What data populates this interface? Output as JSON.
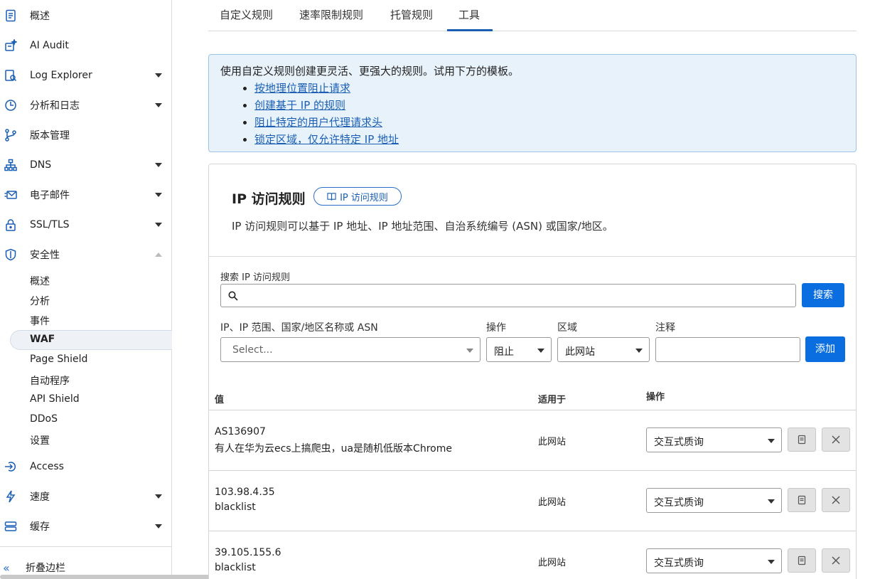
{
  "sidebar": {
    "items": [
      {
        "label": "概述",
        "icon": "document-icon"
      },
      {
        "label": "AI Audit",
        "icon": "ai-audit-icon"
      },
      {
        "label": "Log Explorer",
        "icon": "log-explorer-icon"
      },
      {
        "label": "分析和日志",
        "icon": "clock-chart-icon"
      },
      {
        "label": "版本管理",
        "icon": "branch-icon"
      },
      {
        "label": "DNS",
        "icon": "network-icon"
      },
      {
        "label": "电子邮件",
        "icon": "email-icon"
      },
      {
        "label": "SSL/TLS",
        "icon": "lock-icon"
      },
      {
        "label": "安全性",
        "icon": "shield-icon"
      },
      {
        "label": "Access",
        "icon": "access-icon"
      },
      {
        "label": "速度",
        "icon": "lightning-icon"
      },
      {
        "label": "缓存",
        "icon": "cache-icon"
      }
    ],
    "security_sub": [
      "概述",
      "分析",
      "事件",
      "WAF",
      "Page Shield",
      "自动程序",
      "API Shield",
      "DDoS",
      "设置"
    ],
    "collapse_label": "折叠边栏"
  },
  "tabs": [
    "自定义规则",
    "速率限制规则",
    "托管规则",
    "工具"
  ],
  "info": {
    "text": "使用自定义规则创建更灵活、更强大的规则。试用下方的模板。",
    "links": [
      "按地理位置阻止请求",
      "创建基于 IP 的规则",
      "阻止特定的用户代理请求头",
      "锁定区域，仅允许特定 IP 地址"
    ]
  },
  "card": {
    "title": "IP 访问规则",
    "doc_chip": "IP 访问规则",
    "description": "IP 访问规则可以基于 IP 地址、IP 地址范围、自治系统编号 (ASN) 或国家/地区。",
    "search_label": "搜索 IP 访问规则",
    "search_button": "搜索",
    "form": {
      "target_label": "IP、IP 范围、国家/地区名称或 ASN",
      "target_placeholder": "Select...",
      "action_label": "操作",
      "action_value": "阻止",
      "zone_label": "区域",
      "zone_value": "此网站",
      "note_label": "注释",
      "add_button": "添加"
    },
    "columns": {
      "value": "值",
      "applies_to": "适用于",
      "action": "操作"
    },
    "rows": [
      {
        "value": "AS136907",
        "note": "有人在华为云ecs上搞爬虫，ua是随机低版本Chrome",
        "scope": "此网站",
        "action": "交互式质询"
      },
      {
        "value": "103.98.4.35",
        "note": "blacklist",
        "scope": "此网站",
        "action": "交互式质询"
      },
      {
        "value": "39.105.155.6",
        "note": "blacklist",
        "scope": "此网站",
        "action": "交互式质询"
      }
    ]
  },
  "colors": {
    "accent": "#0a6ee0",
    "link": "#1a5fb4",
    "info_bg": "#e8f2fb"
  }
}
